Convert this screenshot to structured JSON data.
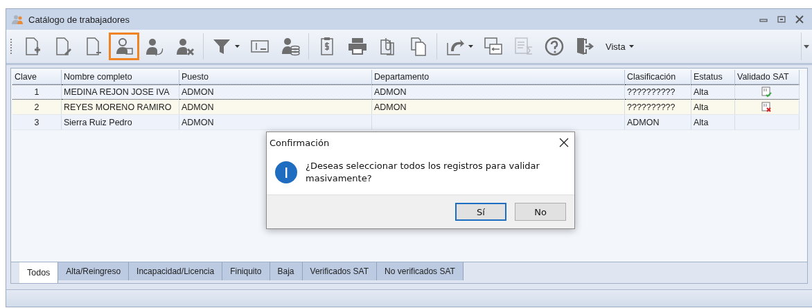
{
  "window": {
    "title": "Catálogo de trabajadores"
  },
  "toolbar": {
    "buttons": [
      {
        "highlighted": false,
        "disabled": false,
        "dropdown": false
      },
      {
        "highlighted": false,
        "disabled": false,
        "dropdown": false
      },
      {
        "highlighted": false,
        "disabled": false,
        "dropdown": false
      },
      {
        "highlighted": true,
        "disabled": false,
        "dropdown": false
      },
      {
        "highlighted": false,
        "disabled": false,
        "dropdown": false
      },
      {
        "highlighted": false,
        "disabled": false,
        "dropdown": false
      },
      {
        "highlighted": false,
        "disabled": false,
        "dropdown": true
      },
      {
        "highlighted": false,
        "disabled": false,
        "dropdown": false
      },
      {
        "highlighted": false,
        "disabled": false,
        "dropdown": false
      },
      {
        "highlighted": false,
        "disabled": false,
        "dropdown": false
      },
      {
        "highlighted": false,
        "disabled": false,
        "dropdown": false
      },
      {
        "highlighted": false,
        "disabled": false,
        "dropdown": false
      },
      {
        "highlighted": false,
        "disabled": false,
        "dropdown": false
      },
      {
        "highlighted": false,
        "disabled": false,
        "dropdown": true
      },
      {
        "highlighted": false,
        "disabled": false,
        "dropdown": false
      },
      {
        "highlighted": false,
        "disabled": true,
        "dropdown": false
      },
      {
        "highlighted": false,
        "disabled": false,
        "dropdown": false
      },
      {
        "highlighted": false,
        "disabled": false,
        "dropdown": false
      }
    ],
    "view_menu": "Vista"
  },
  "table": {
    "columns": [
      "Clave",
      "Nombre completo",
      "Puesto",
      "Departamento",
      "Clasificación",
      "Estatus",
      "Validado SAT"
    ],
    "rows": [
      {
        "selected": true,
        "cells": [
          "1",
          "MEDINA REJON JOSE IVA",
          "ADMON",
          "ADMON",
          "??????????",
          "Alta"
        ],
        "validated": true
      },
      {
        "selected": false,
        "cells": [
          "2",
          "REYES MORENO RAMIRO",
          "ADMON",
          "ADMON",
          "??????????",
          "Alta"
        ],
        "validated": false
      },
      {
        "selected": false,
        "cells": [
          "3",
          "Sierra Ruiz Pedro",
          "ADMON",
          "",
          "ADMON",
          "Alta"
        ]
      }
    ]
  },
  "tabs": [
    {
      "label": "Todos",
      "selected": true
    },
    {
      "label": "Alta/Reingreso",
      "selected": false
    },
    {
      "label": "Incapacidad/Licencia",
      "selected": false
    },
    {
      "label": "Finiquito",
      "selected": false
    },
    {
      "label": "Baja",
      "selected": false
    },
    {
      "label": "Verificados SAT",
      "selected": false
    },
    {
      "label": "No verificados SAT",
      "selected": false
    }
  ],
  "dialog": {
    "title": "Confirmación",
    "message": "¿Deseas seleccionar todos los registros para validar masivamente?",
    "buttons": [
      {
        "label": "Sí",
        "focused": true
      },
      {
        "label": "No",
        "focused": false
      }
    ]
  }
}
